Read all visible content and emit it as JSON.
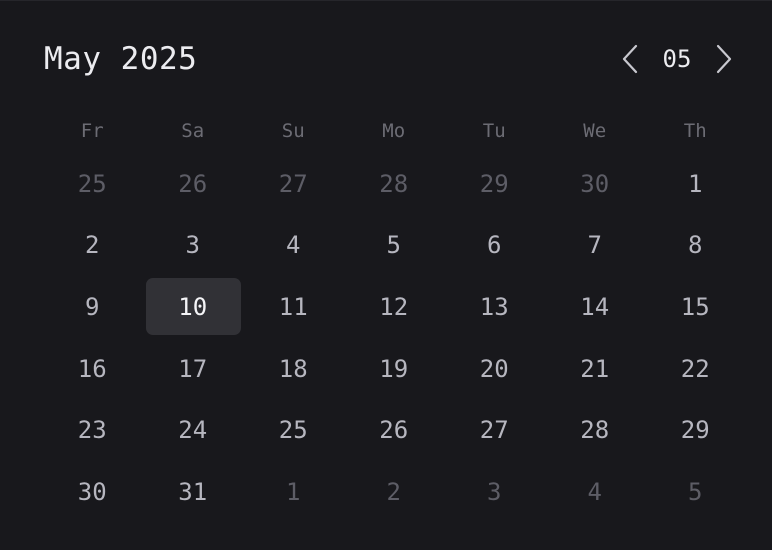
{
  "header": {
    "title": "May 2025",
    "month_number": "05",
    "prev_icon": "chevron-left-icon",
    "next_icon": "chevron-right-icon"
  },
  "weekdays": [
    "Fr",
    "Sa",
    "Su",
    "Mo",
    "Tu",
    "We",
    "Th"
  ],
  "days": [
    {
      "label": "25",
      "outside": true
    },
    {
      "label": "26",
      "outside": true
    },
    {
      "label": "27",
      "outside": true
    },
    {
      "label": "28",
      "outside": true
    },
    {
      "label": "29",
      "outside": true
    },
    {
      "label": "30",
      "outside": true
    },
    {
      "label": "1",
      "outside": false
    },
    {
      "label": "2",
      "outside": false
    },
    {
      "label": "3",
      "outside": false
    },
    {
      "label": "4",
      "outside": false
    },
    {
      "label": "5",
      "outside": false
    },
    {
      "label": "6",
      "outside": false
    },
    {
      "label": "7",
      "outside": false
    },
    {
      "label": "8",
      "outside": false
    },
    {
      "label": "9",
      "outside": false
    },
    {
      "label": "10",
      "outside": false,
      "selected": true
    },
    {
      "label": "11",
      "outside": false
    },
    {
      "label": "12",
      "outside": false
    },
    {
      "label": "13",
      "outside": false
    },
    {
      "label": "14",
      "outside": false
    },
    {
      "label": "15",
      "outside": false
    },
    {
      "label": "16",
      "outside": false
    },
    {
      "label": "17",
      "outside": false
    },
    {
      "label": "18",
      "outside": false
    },
    {
      "label": "19",
      "outside": false
    },
    {
      "label": "20",
      "outside": false
    },
    {
      "label": "21",
      "outside": false
    },
    {
      "label": "22",
      "outside": false
    },
    {
      "label": "23",
      "outside": false
    },
    {
      "label": "24",
      "outside": false
    },
    {
      "label": "25",
      "outside": false
    },
    {
      "label": "26",
      "outside": false
    },
    {
      "label": "27",
      "outside": false
    },
    {
      "label": "28",
      "outside": false
    },
    {
      "label": "29",
      "outside": false
    },
    {
      "label": "30",
      "outside": false
    },
    {
      "label": "31",
      "outside": false
    },
    {
      "label": "1",
      "outside": true
    },
    {
      "label": "2",
      "outside": true
    },
    {
      "label": "3",
      "outside": true
    },
    {
      "label": "4",
      "outside": true
    },
    {
      "label": "5",
      "outside": true
    }
  ],
  "colors": {
    "background": "#18181c",
    "selected_background": "#313136",
    "text_primary": "#ececf0",
    "text_day": "#b6b6bf",
    "text_muted": "#5d5d66",
    "text_weekday": "#6c6c74"
  }
}
